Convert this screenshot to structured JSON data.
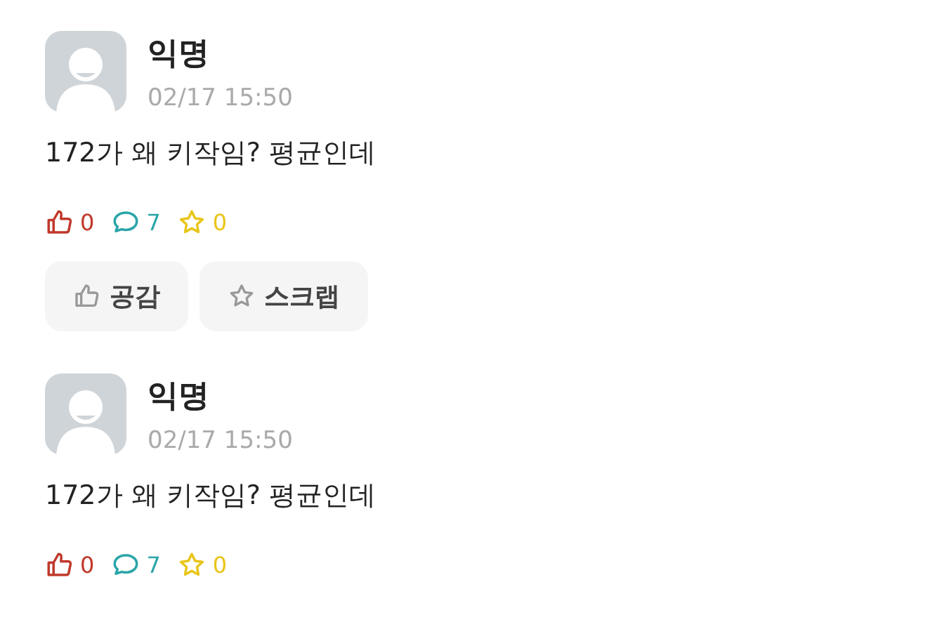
{
  "posts": [
    {
      "author": "익명",
      "time": "02/17 15:50",
      "content": "172가 왜 키작임? 평균인데",
      "likes": "0",
      "comments": "7",
      "scraps": "0",
      "buttons": [
        {
          "kind": "like",
          "label": "공감"
        },
        {
          "kind": "scrap",
          "label": "스크랩"
        }
      ]
    },
    {
      "author": "익명",
      "time": "02/17 15:50",
      "content": "172가 왜 키작임? 평균인데",
      "likes": "0",
      "comments": "7",
      "scraps": "0"
    }
  ]
}
